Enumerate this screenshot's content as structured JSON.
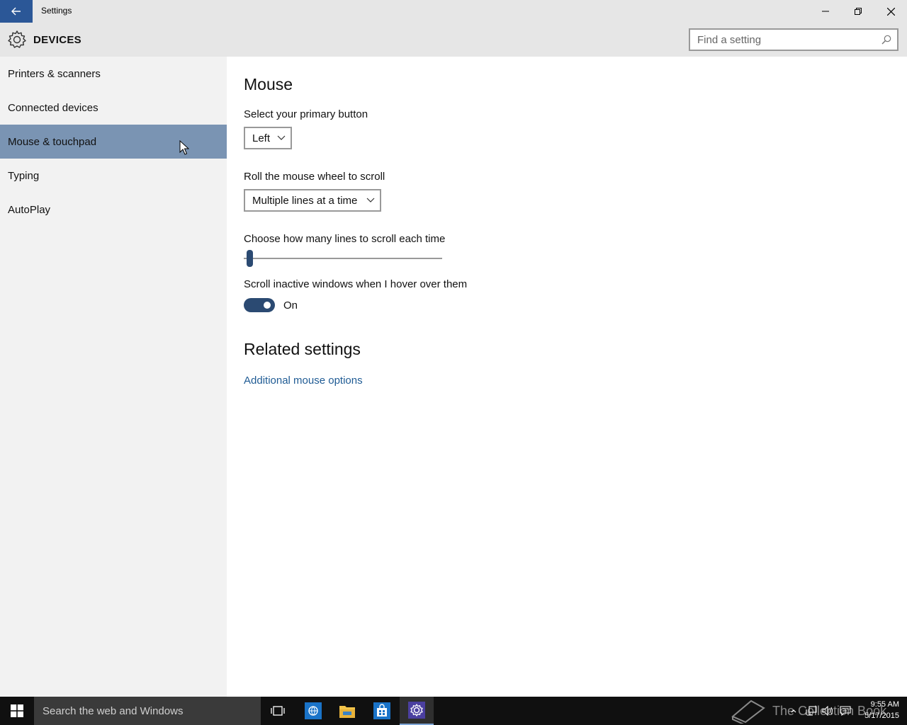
{
  "window": {
    "title": "Settings"
  },
  "header": {
    "section": "DEVICES",
    "search_placeholder": "Find a setting"
  },
  "sidebar": {
    "items": [
      {
        "label": "Printers & scanners"
      },
      {
        "label": "Connected devices"
      },
      {
        "label": "Mouse & touchpad",
        "active": true
      },
      {
        "label": "Typing"
      },
      {
        "label": "AutoPlay"
      }
    ]
  },
  "main": {
    "heading": "Mouse",
    "primary_button": {
      "label": "Select your primary button",
      "value": "Left"
    },
    "wheel_scroll": {
      "label": "Roll the mouse wheel to scroll",
      "value": "Multiple lines at a time"
    },
    "lines_slider": {
      "label": "Choose how many lines to scroll each time",
      "level": 0.03
    },
    "inactive_scroll": {
      "label": "Scroll inactive windows when I hover over them",
      "state": "On"
    },
    "related": {
      "heading": "Related settings",
      "link": "Additional mouse options"
    }
  },
  "taskbar": {
    "search_placeholder": "Search the web and Windows",
    "watermark": "The Collection Book",
    "time": "9:55 AM",
    "date": "5/17/2015"
  },
  "colors": {
    "accent": "#2b5797",
    "active_nav": "#7a94b3",
    "toggle": "#2b4a72",
    "link": "#1f5b94"
  }
}
